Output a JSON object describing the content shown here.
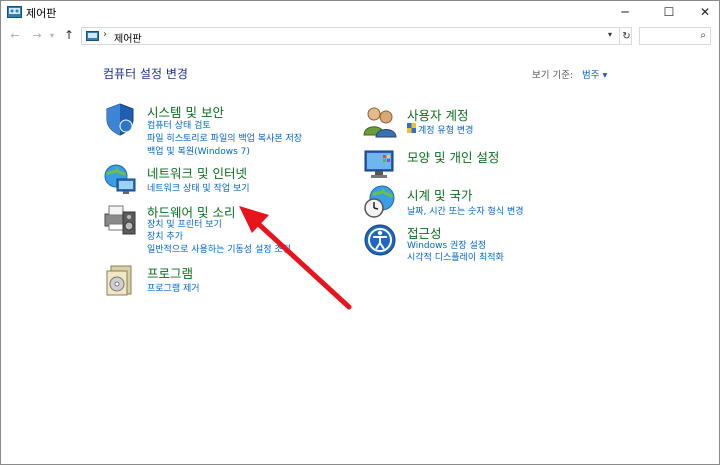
{
  "window": {
    "title": "제어판",
    "minimize_glyph": "─",
    "maximize_glyph": "☐",
    "close_glyph": "✕"
  },
  "nav": {
    "back_glyph": "←",
    "forward_glyph": "→",
    "recent_glyph": "▾",
    "up_glyph": "↑",
    "address_separator": "›",
    "address_text": "제어판",
    "dropdown_glyph": "▾",
    "refresh_glyph": "↻",
    "search_placeholder": "",
    "search_glyph": "⌕"
  },
  "main": {
    "title": "컴퓨터 설정 변경",
    "view_by_label": "보기 기준:",
    "view_by_value": "범주 ▾"
  },
  "categories_left": [
    {
      "title": "시스템 및 보안",
      "links": [
        "컴퓨터 상태 검토",
        "파일 히스토리로 파일의 백업 복사본 저장",
        "백업 및 복원(Windows 7)"
      ]
    },
    {
      "title": "네트워크 및 인터넷",
      "links": [
        "네트워크 상태 및 작업 보기"
      ]
    },
    {
      "title": "하드웨어 및 소리",
      "links": [
        "장치 및 프린터 보기",
        "장치 추가",
        "일반적으로 사용하는 기동성 설정 조정"
      ]
    },
    {
      "title": "프로그램",
      "links": [
        "프로그램 제거"
      ]
    }
  ],
  "categories_right": [
    {
      "title": "사용자 계정",
      "links": [
        "계정 유형 변경"
      ]
    },
    {
      "title": "모양 및 개인 설정",
      "links": []
    },
    {
      "title": "시계 및 국가",
      "links": [
        "날짜, 시간 또는 숫자 형식 변경"
      ]
    },
    {
      "title": "접근성",
      "links": [
        "Windows 권장 설정",
        "시각적 디스플레이 최적화"
      ]
    }
  ],
  "colors": {
    "category_title": "#0a6e1f",
    "link": "#0066cc",
    "heading": "#1e3287",
    "annotation_arrow": "#e8141b"
  }
}
